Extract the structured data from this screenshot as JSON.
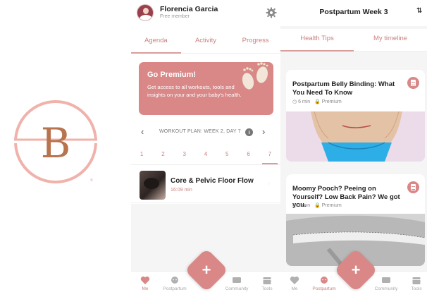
{
  "brand": {
    "logo_letter": "B",
    "accent": "#d98787",
    "accent_light": "#c8817f",
    "logo_color": "#f0b2aa"
  },
  "screen1": {
    "user": {
      "name": "Florencia Garcia",
      "tier": "Free member"
    },
    "tabs": [
      "Agenda",
      "Activity",
      "Progress"
    ],
    "active_tab": "Agenda",
    "premium": {
      "title": "Go Premium!",
      "text": "Get access to all workouts, tools and insights on your and your baby's health."
    },
    "plan": {
      "label": "WORKOUT PLAN: WEEK 2, DAY 7",
      "info_icon": "i"
    },
    "days": [
      "1",
      "2",
      "3",
      "4",
      "5",
      "6",
      "7"
    ],
    "active_day": "7",
    "workout": {
      "title": "Core & Pelvic Floor Flow",
      "duration": "16:09 min"
    },
    "nav": {
      "items": [
        "Me",
        "Postpartum",
        "Community",
        "Tools"
      ],
      "active": "Me",
      "fab": "+"
    }
  },
  "screen2": {
    "title": "Postpartum Week 3",
    "sort_icon": "⇅",
    "tabs": [
      "Health Tips",
      "My timeline"
    ],
    "active_tab": "Health Tips",
    "cards": [
      {
        "title": "Postpartum Belly Binding: What You Need To Know",
        "duration": "6 min",
        "access": "Premium"
      },
      {
        "title": "Moomy Pooch? Peeing on Yourself? Low Back Pain? We got you.",
        "duration": "1 min",
        "access": "Premium"
      }
    ],
    "nav": {
      "items": [
        "Me",
        "Postpartum",
        "Community",
        "Tools"
      ],
      "active": "Postpartum",
      "fab": "+"
    }
  }
}
